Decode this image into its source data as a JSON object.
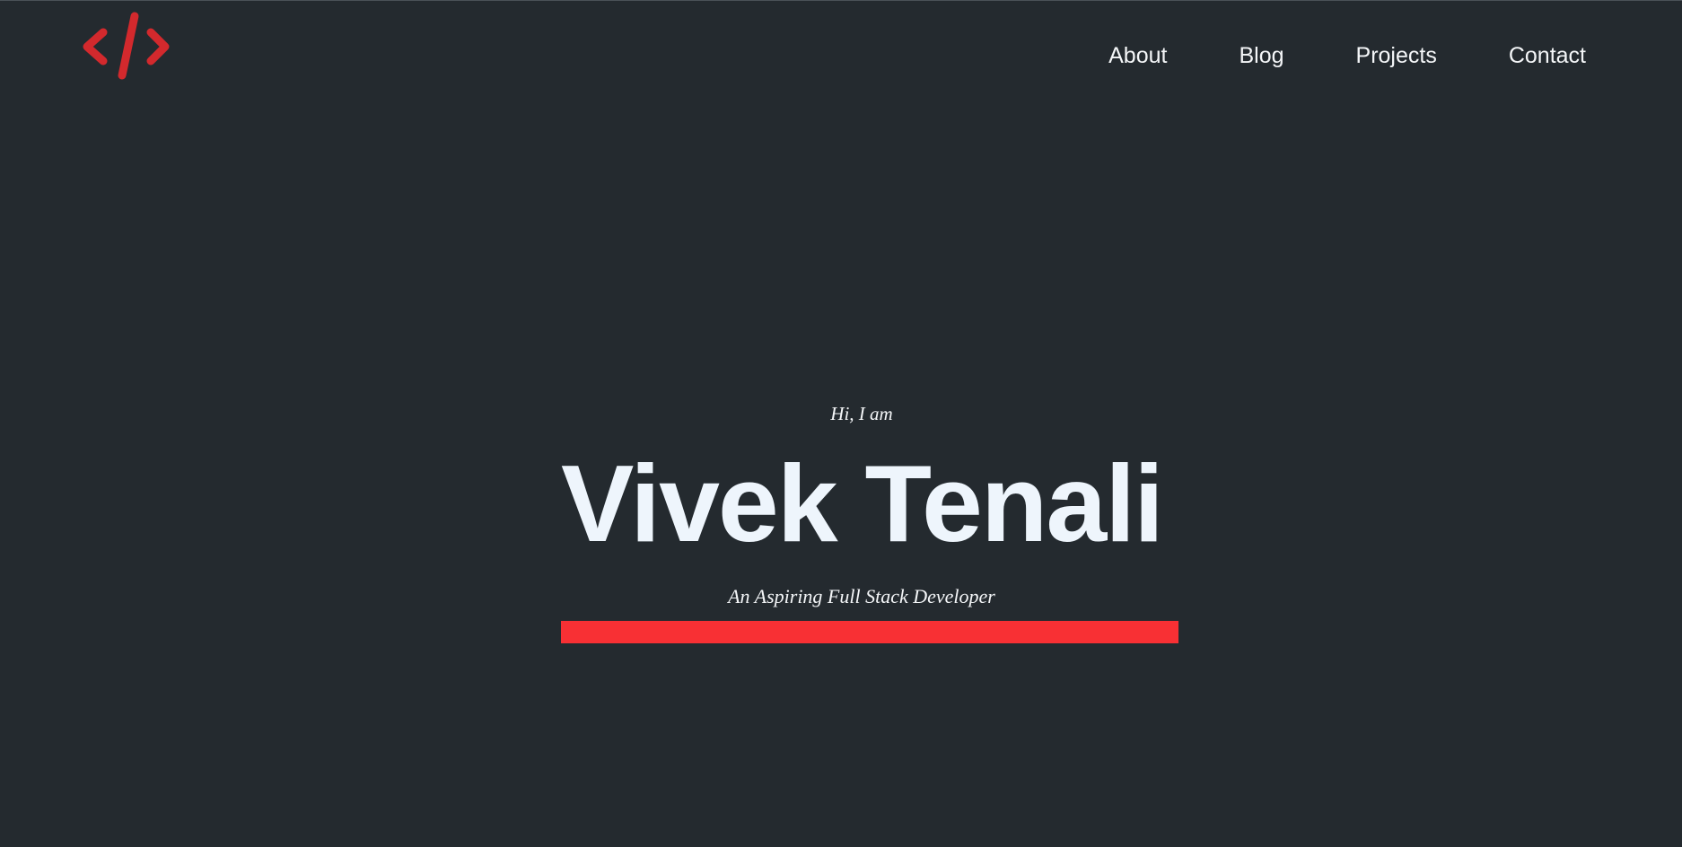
{
  "brand": {
    "logo_icon": "code-brackets-icon",
    "accent_color": "#f83034",
    "logo_color": "#d3292d",
    "background_color": "#242a2f",
    "text_color": "#f4f6f8"
  },
  "nav": {
    "items": [
      {
        "label": "About"
      },
      {
        "label": "Blog"
      },
      {
        "label": "Projects"
      },
      {
        "label": "Contact"
      }
    ]
  },
  "hero": {
    "greeting": "Hi, I am",
    "name": "Vivek Tenali",
    "tagline": "An Aspiring Full Stack Developer"
  }
}
